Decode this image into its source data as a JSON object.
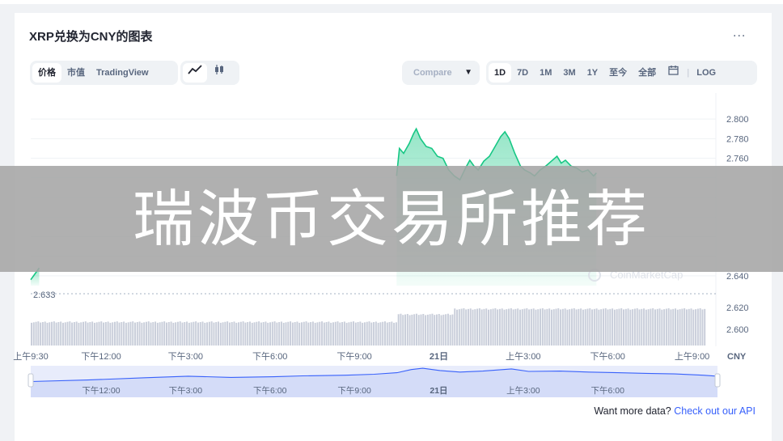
{
  "header": {
    "title": "XRP兑换为CNY的图表",
    "more_label": "..."
  },
  "toolbar": {
    "view_tabs": [
      {
        "label": "价格",
        "active": true
      },
      {
        "label": "市值",
        "active": false
      },
      {
        "label": "TradingView",
        "active": false
      }
    ],
    "chart_type_icons": [
      "line-chart-icon",
      "candlestick-icon"
    ],
    "compare_label": "Compare ",
    "range_tabs": [
      {
        "label": "1D",
        "active": true
      },
      {
        "label": "7D",
        "active": false
      },
      {
        "label": "1M",
        "active": false
      },
      {
        "label": "3M",
        "active": false
      },
      {
        "label": "1Y",
        "active": false
      },
      {
        "label": "至今",
        "active": false
      },
      {
        "label": "全部",
        "active": false
      }
    ],
    "calendar_icon": "calendar-icon",
    "log_label": "LOG"
  },
  "watermark_text": "瑞波币交易所推荐",
  "footer": {
    "api_text": "Want more data?",
    "api_link": "Check out our API"
  },
  "chart_data": {
    "type": "area",
    "currency_label": "CNY",
    "open_price_label": "2.633",
    "watermark_logo": "CoinMarketCap",
    "y_ticks": [
      2.8,
      2.78,
      2.76,
      2.74,
      2.72,
      2.7,
      2.68,
      2.66,
      2.64
    ],
    "y_tick_labels": [
      "2.800",
      "2.780",
      "2.760",
      "",
      "",
      "",
      "",
      "",
      "2.640"
    ],
    "ylim": [
      2.63,
      2.81
    ],
    "volume_ticks": [
      "2.620",
      "2.600"
    ],
    "volume_ylim": [
      2.59,
      2.627
    ],
    "x_labels": [
      "上午9:30",
      "下午12:00",
      "下午3:00",
      "下午6:00",
      "下午9:00",
      "21日",
      "上午3:00",
      "下午6:00",
      "上午9:00"
    ],
    "x_hours": [
      0,
      2.5,
      5.5,
      8.5,
      11.5,
      14.5,
      17.5,
      20.5,
      23.5
    ],
    "navigator_labels": [
      "下午12:00",
      "下午3:00",
      "下午6:00",
      "下午9:00",
      "21日",
      "上午3:00",
      "下午6:00"
    ],
    "navigator_hours": [
      2.5,
      5.5,
      8.5,
      11.5,
      14.5,
      17.5,
      20.5
    ],
    "price_points": [
      [
        0,
        2.636
      ],
      [
        0.15,
        2.642
      ],
      [
        0.3,
        2.648
      ],
      [
        13,
        2.742
      ],
      [
        13.1,
        2.77
      ],
      [
        13.25,
        2.765
      ],
      [
        13.45,
        2.775
      ],
      [
        13.6,
        2.785
      ],
      [
        13.7,
        2.79
      ],
      [
        13.85,
        2.78
      ],
      [
        14.05,
        2.772
      ],
      [
        14.25,
        2.77
      ],
      [
        14.45,
        2.762
      ],
      [
        14.65,
        2.76
      ],
      [
        14.85,
        2.748
      ],
      [
        15.05,
        2.742
      ],
      [
        15.25,
        2.738
      ],
      [
        15.45,
        2.75
      ],
      [
        15.6,
        2.758
      ],
      [
        15.75,
        2.752
      ],
      [
        15.9,
        2.748
      ],
      [
        16.1,
        2.757
      ],
      [
        16.3,
        2.762
      ],
      [
        16.5,
        2.772
      ],
      [
        16.7,
        2.782
      ],
      [
        16.85,
        2.787
      ],
      [
        17.0,
        2.78
      ],
      [
        17.2,
        2.765
      ],
      [
        17.4,
        2.752
      ],
      [
        17.55,
        2.748
      ],
      [
        17.75,
        2.745
      ],
      [
        17.9,
        2.742
      ],
      [
        18.1,
        2.748
      ],
      [
        18.3,
        2.752
      ],
      [
        18.5,
        2.757
      ],
      [
        18.7,
        2.762
      ],
      [
        18.85,
        2.755
      ],
      [
        19.0,
        2.758
      ],
      [
        19.2,
        2.752
      ],
      [
        19.4,
        2.75
      ],
      [
        19.6,
        2.746
      ],
      [
        19.8,
        2.748
      ],
      [
        20.0,
        2.742
      ],
      [
        20.1,
        2.745
      ]
    ],
    "volume_base": 2.607,
    "volume_step_levels": [
      {
        "from": 0,
        "to": 13,
        "value": 2.606
      },
      {
        "from": 13,
        "to": 15,
        "value": 2.613
      },
      {
        "from": 15,
        "to": 24,
        "value": 2.618
      }
    ],
    "navigator_points": [
      [
        0,
        0.5
      ],
      [
        2,
        0.45
      ],
      [
        4,
        0.38
      ],
      [
        5.5,
        0.33
      ],
      [
        7,
        0.37
      ],
      [
        8.5,
        0.35
      ],
      [
        9.5,
        0.32
      ],
      [
        11,
        0.3
      ],
      [
        12,
        0.27
      ],
      [
        12.8,
        0.22
      ],
      [
        13.3,
        0.12
      ],
      [
        13.7,
        0.08
      ],
      [
        14.3,
        0.15
      ],
      [
        15,
        0.2
      ],
      [
        15.8,
        0.17
      ],
      [
        16.8,
        0.1
      ],
      [
        17.4,
        0.18
      ],
      [
        18.5,
        0.17
      ],
      [
        19.5,
        0.2
      ],
      [
        20.5,
        0.22
      ],
      [
        21.5,
        0.24
      ],
      [
        22.5,
        0.26
      ],
      [
        23.5,
        0.3
      ],
      [
        24,
        0.33
      ]
    ]
  }
}
